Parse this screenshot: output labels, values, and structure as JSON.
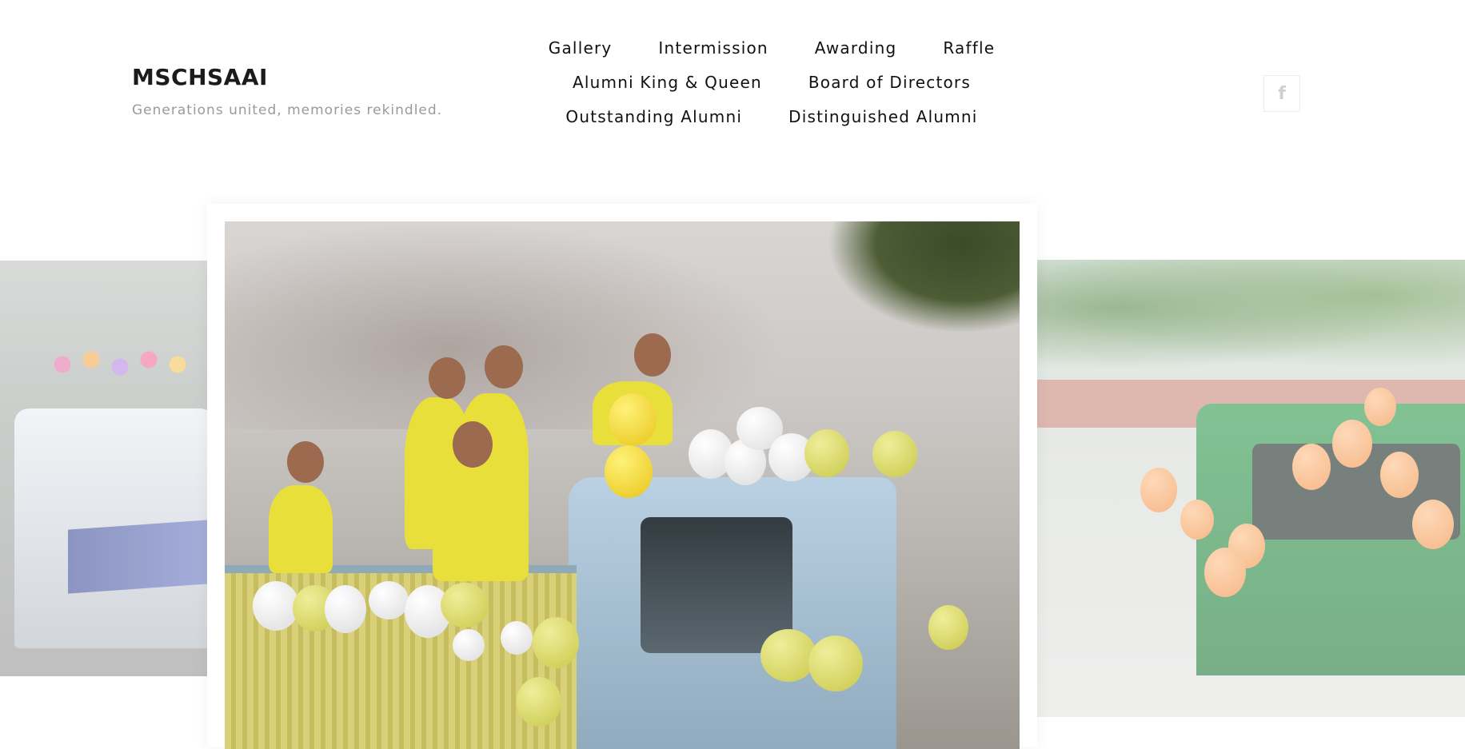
{
  "header": {
    "title": "MSCHSAAI",
    "tagline": "Generations united, memories rekindled."
  },
  "nav": {
    "rows": [
      [
        "Gallery",
        "Intermission",
        "Awarding",
        "Raffle"
      ],
      [
        "Alumni King & Queen",
        "Board of Directors"
      ],
      [
        "Outstanding Alumni",
        "Distinguished Alumni"
      ]
    ]
  },
  "social": {
    "facebook_glyph": "f",
    "icon": "facebook-icon"
  },
  "slider": {
    "slides": [
      {
        "position": "previous",
        "accent": "#6070c0"
      },
      {
        "position": "current",
        "accent": "#e9df3a"
      },
      {
        "position": "next",
        "accent": "#f08a3a"
      }
    ]
  }
}
